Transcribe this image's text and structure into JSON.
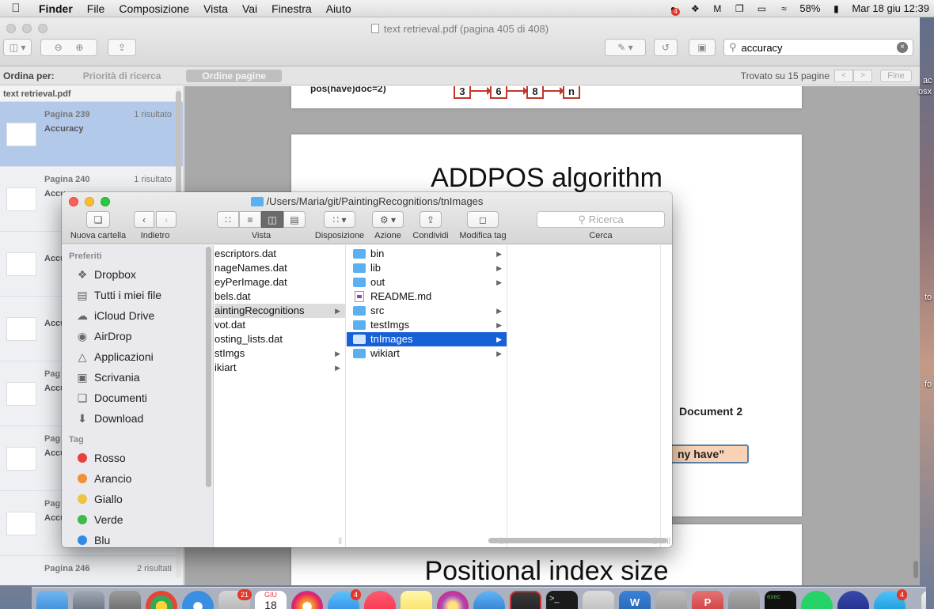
{
  "menubar": {
    "app": "Finder",
    "items": [
      "File",
      "Composizione",
      "Vista",
      "Vai",
      "Finestra",
      "Aiuto"
    ],
    "status": {
      "badge": "4",
      "battery": "58%",
      "datetime": "Mar 18 giu  12:39"
    }
  },
  "preview": {
    "title": "text retrieval.pdf (pagina 405 di 408)",
    "search": {
      "value": "accuracy",
      "placeholder": ""
    },
    "sortbar": {
      "label": "Ordina per:",
      "opt_priority": "Priorità di ricerca",
      "opt_pages": "Ordine pagine",
      "found": "Trovato su 15 pagine",
      "prev": "<",
      "next": ">",
      "done": "Fine"
    },
    "results": {
      "file": "text retrieval.pdf",
      "items": [
        {
          "page": "Pagina 239",
          "count": "1 risultato",
          "snippet": "Accuracy"
        },
        {
          "page": "Pagina 240",
          "count": "1 risultato",
          "snippet": "Accu"
        },
        {
          "page": "",
          "count": "",
          "snippet": "Accu"
        },
        {
          "page": "",
          "count": "",
          "snippet": "Accu"
        },
        {
          "page": "Pag",
          "count": "",
          "snippet": "Accu"
        },
        {
          "page": "Pag",
          "count": "",
          "snippet": "Accu"
        },
        {
          "page": "Pag",
          "count": "",
          "snippet": "Accu"
        },
        {
          "page": "Pagina 246",
          "count": "2 risultati",
          "snippet": ""
        }
      ]
    },
    "pdf": {
      "top_fragment": "pos(have)doc=2)",
      "chain": [
        "3",
        "6",
        "8",
        "n"
      ],
      "slide1_title": "ADDPOS algorithm",
      "doc2_label": "Document 2",
      "quote_text": "ny have”",
      "slide2_title": "Positional index size"
    }
  },
  "finder": {
    "title": "/Users/Maria/git/PaintingRecognitions/tnImages",
    "toolbar": {
      "new_folder": "Nuova cartella",
      "back": "Indietro",
      "view": "Vista",
      "arrange": "Disposizione",
      "action": "Azione",
      "share": "Condividi",
      "edit_tags": "Modifica tag",
      "search_label": "Cerca",
      "search_placeholder": "Ricerca"
    },
    "sidebar": {
      "favorites_header": "Preferiti",
      "favorites": [
        "Dropbox",
        "Tutti i miei file",
        "iCloud Drive",
        "AirDrop",
        "Applicazioni",
        "Scrivania",
        "Documenti",
        "Download"
      ],
      "tags_header": "Tag",
      "tags": [
        {
          "name": "Rosso",
          "color": "#e8403a"
        },
        {
          "name": "Arancio",
          "color": "#f0913a"
        },
        {
          "name": "Giallo",
          "color": "#efc23f"
        },
        {
          "name": "Verde",
          "color": "#3fb94c"
        },
        {
          "name": "Blu",
          "color": "#2f8be6"
        }
      ]
    },
    "col1": [
      "escriptors.dat",
      "nageNames.dat",
      "eyPerImage.dat",
      "bels.dat",
      "aintingRecognitions",
      "vot.dat",
      "osting_lists.dat",
      "stImgs",
      "ikiart"
    ],
    "col2": [
      "bin",
      "lib",
      "out",
      "README.md",
      "src",
      "testImgs",
      "tnImages",
      "wikiart"
    ]
  },
  "desktop": {
    "frag1": "ac",
    "frag2": "osx",
    "frag3": "to",
    "frag4": "fo"
  },
  "dock": {
    "badges": {
      "calendar": "21",
      "appstore": "4",
      "telegram": "4"
    },
    "calendar_month": "GIU",
    "calendar_day": "18"
  }
}
